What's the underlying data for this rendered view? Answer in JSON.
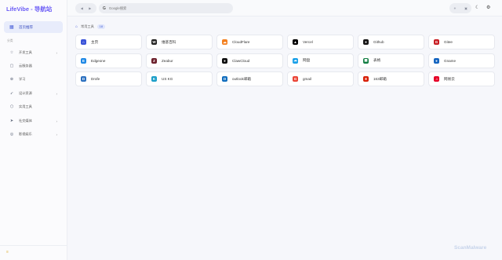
{
  "sidebar": {
    "brand": "LifeVibe - 导航站",
    "home_label": "首页推荐",
    "section_label": "分类",
    "items": [
      {
        "label": "开发工具",
        "icon": "star-icon",
        "glyph": "☆",
        "has_chevron": true
      },
      {
        "label": "云服务器",
        "icon": "calendar-icon",
        "glyph": "▢",
        "has_chevron": false
      },
      {
        "label": "学习",
        "icon": "lock-icon",
        "glyph": "⊕",
        "has_chevron": false
      },
      {
        "label": "设计资源",
        "icon": "rocket-icon",
        "glyph": "➶",
        "has_chevron": true
      },
      {
        "label": "实用工具",
        "icon": "box-icon",
        "glyph": "⬡",
        "has_chevron": false
      },
      {
        "label": "社交媒体",
        "icon": "send-icon",
        "glyph": "➤",
        "has_chevron": true
      },
      {
        "label": "影视娱乐",
        "icon": "globe-icon",
        "glyph": "◎",
        "has_chevron": true
      }
    ]
  },
  "topbar": {
    "search_engine": "G",
    "search_placeholder": "Google搜索"
  },
  "group": {
    "label": "常用工具",
    "count": "18"
  },
  "cards": [
    {
      "name": "主页",
      "icon_name": "home-icon",
      "glyph": "⌂",
      "color": "#3a53d8"
    },
    {
      "name": "维基百科",
      "icon_name": "wikipedia-icon",
      "glyph": "W",
      "color": "#222222"
    },
    {
      "name": "CloudFlare",
      "icon_name": "cloudflare-icon",
      "glyph": "☁",
      "color": "#f38020"
    },
    {
      "name": "Vercel",
      "icon_name": "vercel-icon",
      "glyph": "▲",
      "color": "#000000"
    },
    {
      "name": "Github",
      "icon_name": "github-icon",
      "glyph": "●",
      "color": "#181717"
    },
    {
      "name": "Gitee",
      "icon_name": "gitee-icon",
      "glyph": "G",
      "color": "#c71d23"
    },
    {
      "name": "Edgeone",
      "icon_name": "edgeone-icon",
      "glyph": "E",
      "color": "#1e88e5"
    },
    {
      "name": "Zeabur",
      "icon_name": "zeabur-icon",
      "glyph": "Z",
      "color": "#6b1e2a"
    },
    {
      "name": "ClawCloud",
      "icon_name": "clawcloud-icon",
      "glyph": "●",
      "color": "#111111"
    },
    {
      "name": "网盘",
      "icon_name": "cloud-drive-icon",
      "glyph": "☁",
      "color": "#1aa0e8"
    },
    {
      "name": "表格",
      "icon_name": "spreadsheet-icon",
      "glyph": "▦",
      "color": "#107c41"
    },
    {
      "name": "Gname",
      "icon_name": "gname-icon",
      "glyph": "●",
      "color": "#1565c0"
    },
    {
      "name": "Drofe",
      "icon_name": "drofe-icon",
      "glyph": "D",
      "color": "#2a6fbf"
    },
    {
      "name": "US KG",
      "icon_name": "uskg-icon",
      "glyph": "K",
      "color": "#1a9ec8"
    },
    {
      "name": "outlook邮箱",
      "icon_name": "outlook-icon",
      "glyph": "O",
      "color": "#0f6cbd"
    },
    {
      "name": "gmail",
      "icon_name": "gmail-icon",
      "glyph": "G",
      "color": "#ea4335"
    },
    {
      "name": "163邮箱",
      "icon_name": "mail163-icon",
      "glyph": "8",
      "color": "#d81e06"
    },
    {
      "name": "网易云",
      "icon_name": "netease-icon",
      "glyph": "♫",
      "color": "#e60026"
    }
  ],
  "watermark": "ScanMalware"
}
